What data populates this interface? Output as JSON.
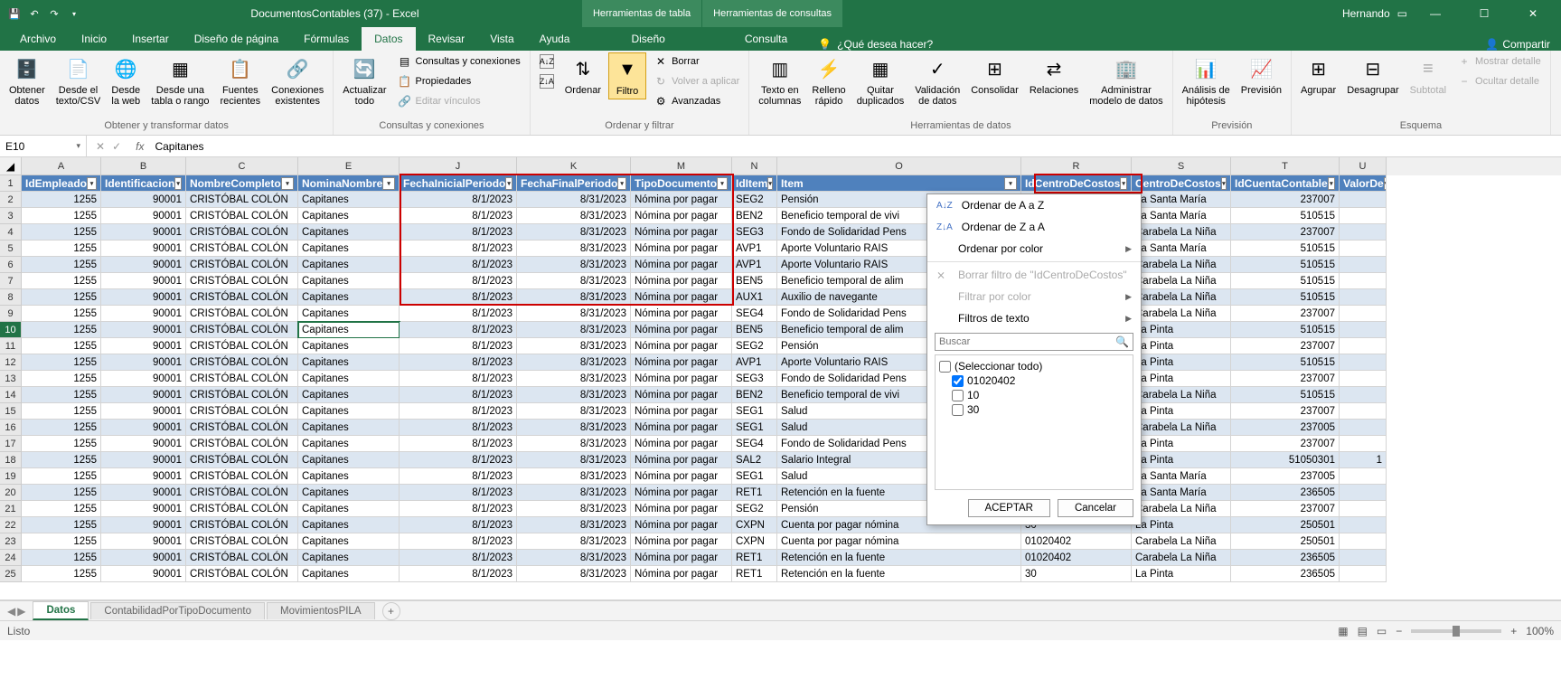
{
  "titlebar": {
    "title": "DocumentosContables (37) - Excel",
    "tool1": "Herramientas de tabla",
    "tool2": "Herramientas de consultas",
    "user": "Hernando"
  },
  "tabs": {
    "file": "Archivo",
    "home": "Inicio",
    "insert": "Insertar",
    "layout": "Diseño de página",
    "formulas": "Fórmulas",
    "data": "Datos",
    "review": "Revisar",
    "view": "Vista",
    "help": "Ayuda",
    "design": "Diseño",
    "query": "Consulta",
    "tell": "¿Qué desea hacer?",
    "share": "Compartir"
  },
  "ribbon": {
    "g1": {
      "label": "Obtener y transformar datos",
      "b1": "Obtener\ndatos",
      "b2": "Desde el\ntexto/CSV",
      "b3": "Desde\nla web",
      "b4": "Desde una\ntabla o rango",
      "b5": "Fuentes\nrecientes",
      "b6": "Conexiones\nexistentes"
    },
    "g2": {
      "label": "Consultas y conexiones",
      "b1": "Actualizar\ntodo",
      "s1": "Consultas y conexiones",
      "s2": "Propiedades",
      "s3": "Editar vínculos"
    },
    "g3": {
      "label": "Ordenar y filtrar",
      "b1": "Ordenar",
      "b2": "Filtro",
      "s1": "Borrar",
      "s2": "Volver a aplicar",
      "s3": "Avanzadas"
    },
    "g4": {
      "label": "Herramientas de datos",
      "b1": "Texto en\ncolumnas",
      "b2": "Relleno\nrápido",
      "b3": "Quitar\nduplicados",
      "b4": "Validación\nde datos",
      "b5": "Consolidar",
      "b6": "Relaciones",
      "b7": "Administrar\nmodelo de datos"
    },
    "g5": {
      "label": "Previsión",
      "b1": "Análisis de\nhipótesis",
      "b2": "Previsión"
    },
    "g6": {
      "label": "Esquema",
      "b1": "Agrupar",
      "b2": "Desagrupar",
      "b3": "Subtotal",
      "s1": "Mostrar detalle",
      "s2": "Ocultar detalle"
    }
  },
  "namebox": "E10",
  "formula": "Capitanes",
  "colLetters": [
    "A",
    "B",
    "C",
    "E",
    "J",
    "K",
    "M",
    "N",
    "O",
    "R",
    "S",
    "T",
    "U"
  ],
  "headers": [
    "IdEmpleado",
    "Identificacion",
    "NombreCompleto",
    "NominaNombre",
    "FechaInicialPeriodo",
    "FechaFinalPeriodo",
    "TipoDocumento",
    "IdItem",
    "Item",
    "IdCentroDeCostos",
    "CentroDeCostos",
    "IdCuentaContable",
    "ValorDe"
  ],
  "rows": [
    {
      "n": 2,
      "d": [
        "1255",
        "90001",
        "CRISTÓBAL COLÓN",
        "Capitanes",
        "8/1/2023",
        "8/31/2023",
        "Nómina por pagar",
        "SEG2",
        "Pensión",
        "",
        "La Santa María",
        "237007",
        ""
      ]
    },
    {
      "n": 3,
      "d": [
        "1255",
        "90001",
        "CRISTÓBAL COLÓN",
        "Capitanes",
        "8/1/2023",
        "8/31/2023",
        "Nómina por pagar",
        "BEN2",
        "Beneficio temporal de vivi",
        "",
        "La Santa María",
        "510515",
        ""
      ]
    },
    {
      "n": 4,
      "d": [
        "1255",
        "90001",
        "CRISTÓBAL COLÓN",
        "Capitanes",
        "8/1/2023",
        "8/31/2023",
        "Nómina por pagar",
        "SEG3",
        "Fondo de Solidaridad Pens",
        "",
        "Carabela La Niña",
        "237007",
        ""
      ]
    },
    {
      "n": 5,
      "d": [
        "1255",
        "90001",
        "CRISTÓBAL COLÓN",
        "Capitanes",
        "8/1/2023",
        "8/31/2023",
        "Nómina por pagar",
        "AVP1",
        "Aporte Voluntario RAIS",
        "",
        "La Santa María",
        "510515",
        ""
      ]
    },
    {
      "n": 6,
      "d": [
        "1255",
        "90001",
        "CRISTÓBAL COLÓN",
        "Capitanes",
        "8/1/2023",
        "8/31/2023",
        "Nómina por pagar",
        "AVP1",
        "Aporte Voluntario RAIS",
        "",
        "Carabela La Niña",
        "510515",
        ""
      ]
    },
    {
      "n": 7,
      "d": [
        "1255",
        "90001",
        "CRISTÓBAL COLÓN",
        "Capitanes",
        "8/1/2023",
        "8/31/2023",
        "Nómina por pagar",
        "BEN5",
        "Beneficio temporal de alim",
        "",
        "Carabela La Niña",
        "510515",
        ""
      ]
    },
    {
      "n": 8,
      "d": [
        "1255",
        "90001",
        "CRISTÓBAL COLÓN",
        "Capitanes",
        "8/1/2023",
        "8/31/2023",
        "Nómina por pagar",
        "AUX1",
        "Auxilio de navegante",
        "",
        "Carabela La Niña",
        "510515",
        ""
      ]
    },
    {
      "n": 9,
      "d": [
        "1255",
        "90001",
        "CRISTÓBAL COLÓN",
        "Capitanes",
        "8/1/2023",
        "8/31/2023",
        "Nómina por pagar",
        "SEG4",
        "Fondo de Solidaridad Pens",
        "",
        "Carabela La Niña",
        "237007",
        ""
      ]
    },
    {
      "n": 10,
      "d": [
        "1255",
        "90001",
        "CRISTÓBAL COLÓN",
        "Capitanes",
        "8/1/2023",
        "8/31/2023",
        "Nómina por pagar",
        "BEN5",
        "Beneficio temporal de alim",
        "",
        "La Pinta",
        "510515",
        ""
      ]
    },
    {
      "n": 11,
      "d": [
        "1255",
        "90001",
        "CRISTÓBAL COLÓN",
        "Capitanes",
        "8/1/2023",
        "8/31/2023",
        "Nómina por pagar",
        "SEG2",
        "Pensión",
        "",
        "La Pinta",
        "237007",
        ""
      ]
    },
    {
      "n": 12,
      "d": [
        "1255",
        "90001",
        "CRISTÓBAL COLÓN",
        "Capitanes",
        "8/1/2023",
        "8/31/2023",
        "Nómina por pagar",
        "AVP1",
        "Aporte Voluntario RAIS",
        "",
        "La Pinta",
        "510515",
        ""
      ]
    },
    {
      "n": 13,
      "d": [
        "1255",
        "90001",
        "CRISTÓBAL COLÓN",
        "Capitanes",
        "8/1/2023",
        "8/31/2023",
        "Nómina por pagar",
        "SEG3",
        "Fondo de Solidaridad Pens",
        "",
        "La Pinta",
        "237007",
        ""
      ]
    },
    {
      "n": 14,
      "d": [
        "1255",
        "90001",
        "CRISTÓBAL COLÓN",
        "Capitanes",
        "8/1/2023",
        "8/31/2023",
        "Nómina por pagar",
        "BEN2",
        "Beneficio temporal de vivi",
        "",
        "Carabela La Niña",
        "510515",
        ""
      ]
    },
    {
      "n": 15,
      "d": [
        "1255",
        "90001",
        "CRISTÓBAL COLÓN",
        "Capitanes",
        "8/1/2023",
        "8/31/2023",
        "Nómina por pagar",
        "SEG1",
        "Salud",
        "",
        "La Pinta",
        "237007",
        ""
      ]
    },
    {
      "n": 16,
      "d": [
        "1255",
        "90001",
        "CRISTÓBAL COLÓN",
        "Capitanes",
        "8/1/2023",
        "8/31/2023",
        "Nómina por pagar",
        "SEG1",
        "Salud",
        "",
        "Carabela La Niña",
        "237005",
        ""
      ]
    },
    {
      "n": 17,
      "d": [
        "1255",
        "90001",
        "CRISTÓBAL COLÓN",
        "Capitanes",
        "8/1/2023",
        "8/31/2023",
        "Nómina por pagar",
        "SEG4",
        "Fondo de Solidaridad Pens",
        "",
        "La Pinta",
        "237007",
        ""
      ]
    },
    {
      "n": 18,
      "d": [
        "1255",
        "90001",
        "CRISTÓBAL COLÓN",
        "Capitanes",
        "8/1/2023",
        "8/31/2023",
        "Nómina por pagar",
        "SAL2",
        "Salario Integral",
        "",
        "La Pinta",
        "51050301",
        "1"
      ]
    },
    {
      "n": 19,
      "d": [
        "1255",
        "90001",
        "CRISTÓBAL COLÓN",
        "Capitanes",
        "8/1/2023",
        "8/31/2023",
        "Nómina por pagar",
        "SEG1",
        "Salud",
        "",
        "La Santa María",
        "237005",
        ""
      ]
    },
    {
      "n": 20,
      "d": [
        "1255",
        "90001",
        "CRISTÓBAL COLÓN",
        "Capitanes",
        "8/1/2023",
        "8/31/2023",
        "Nómina por pagar",
        "RET1",
        "Retención en la fuente",
        "",
        "La Santa María",
        "236505",
        ""
      ]
    },
    {
      "n": 21,
      "d": [
        "1255",
        "90001",
        "CRISTÓBAL COLÓN",
        "Capitanes",
        "8/1/2023",
        "8/31/2023",
        "Nómina por pagar",
        "SEG2",
        "Pensión",
        "",
        "Carabela La Niña",
        "237007",
        ""
      ]
    },
    {
      "n": 22,
      "d": [
        "1255",
        "90001",
        "CRISTÓBAL COLÓN",
        "Capitanes",
        "8/1/2023",
        "8/31/2023",
        "Nómina por pagar",
        "CXPN",
        "Cuenta por pagar nómina",
        "30",
        "La Pinta",
        "250501",
        ""
      ]
    },
    {
      "n": 23,
      "d": [
        "1255",
        "90001",
        "CRISTÓBAL COLÓN",
        "Capitanes",
        "8/1/2023",
        "8/31/2023",
        "Nómina por pagar",
        "CXPN",
        "Cuenta por pagar nómina",
        "01020402",
        "Carabela La Niña",
        "250501",
        ""
      ]
    },
    {
      "n": 24,
      "d": [
        "1255",
        "90001",
        "CRISTÓBAL COLÓN",
        "Capitanes",
        "8/1/2023",
        "8/31/2023",
        "Nómina por pagar",
        "RET1",
        "Retención en la fuente",
        "01020402",
        "Carabela La Niña",
        "236505",
        ""
      ]
    },
    {
      "n": 25,
      "d": [
        "1255",
        "90001",
        "CRISTÓBAL COLÓN",
        "Capitanes",
        "8/1/2023",
        "8/31/2023",
        "Nómina por pagar",
        "RET1",
        "Retención en la fuente",
        "30",
        "La Pinta",
        "236505",
        ""
      ]
    }
  ],
  "filter": {
    "sortAZ": "Ordenar de A a Z",
    "sortZA": "Ordenar de Z a A",
    "sortColor": "Ordenar por color",
    "clear": "Borrar filtro de \"IdCentroDeCostos\"",
    "byColor": "Filtrar por color",
    "textFilters": "Filtros de texto",
    "search": "Buscar",
    "selectAll": "(Seleccionar todo)",
    "opt1": "01020402",
    "opt2": "10",
    "opt3": "30",
    "ok": "ACEPTAR",
    "cancel": "Cancelar"
  },
  "sheets": {
    "s1": "Datos",
    "s2": "ContabilidadPorTipoDocumento",
    "s3": "MovimientosPILA"
  },
  "status": {
    "ready": "Listo",
    "zoom": "100%"
  }
}
